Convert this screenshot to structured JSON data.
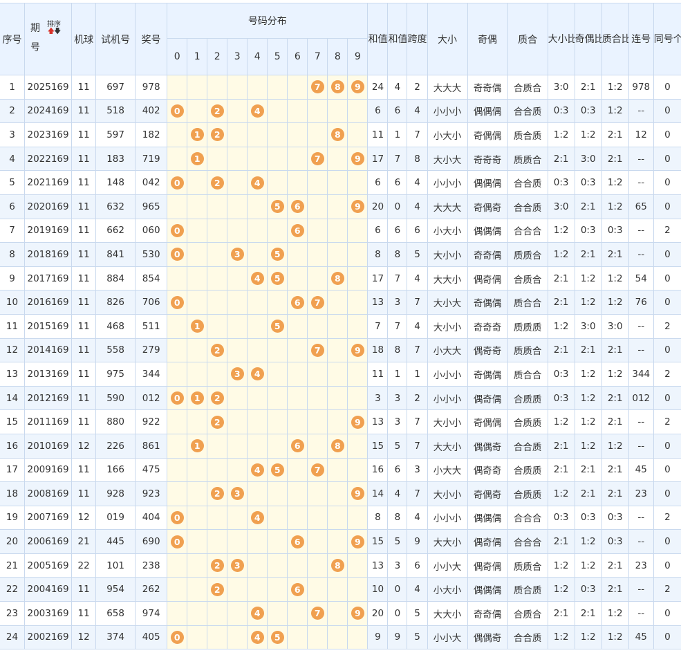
{
  "header": {
    "seq": "序号",
    "issue": "期号",
    "sort_label": "排序",
    "machine": "机球",
    "trial": "试机号",
    "prize": "奖号",
    "distribution": "号码分布",
    "digits": [
      "0",
      "1",
      "2",
      "3",
      "4",
      "5",
      "6",
      "7",
      "8",
      "9"
    ],
    "sum": "和值",
    "sum_tail": "和值尾",
    "span": "跨度",
    "size": "大小",
    "parity": "奇偶",
    "prime": "质合",
    "size_ratio": "大小比",
    "parity_ratio": "奇偶比",
    "prime_ratio": "质合比",
    "consecutive": "连号",
    "same_count": "同号个数"
  },
  "rows": [
    {
      "seq": "1",
      "issue": "2025169",
      "machine": "11",
      "trial": "697",
      "prize": "978",
      "sum": "24",
      "tail": "4",
      "span": "2",
      "size": "大大大",
      "parity": "奇奇偶",
      "prime": "合质合",
      "size_ratio": "3:0",
      "parity_ratio": "2:1",
      "prime_ratio": "1:2",
      "consec": "978",
      "same": "0"
    },
    {
      "seq": "2",
      "issue": "2024169",
      "machine": "11",
      "trial": "518",
      "prize": "402",
      "sum": "6",
      "tail": "6",
      "span": "4",
      "size": "小小小",
      "parity": "偶偶偶",
      "prime": "合合质",
      "size_ratio": "0:3",
      "parity_ratio": "0:3",
      "prime_ratio": "1:2",
      "consec": "--",
      "same": "0"
    },
    {
      "seq": "3",
      "issue": "2023169",
      "machine": "11",
      "trial": "597",
      "prize": "182",
      "sum": "11",
      "tail": "1",
      "span": "7",
      "size": "小大小",
      "parity": "奇偶偶",
      "prime": "质合质",
      "size_ratio": "1:2",
      "parity_ratio": "1:2",
      "prime_ratio": "2:1",
      "consec": "12",
      "same": "0"
    },
    {
      "seq": "4",
      "issue": "2022169",
      "machine": "11",
      "trial": "183",
      "prize": "719",
      "sum": "17",
      "tail": "7",
      "span": "8",
      "size": "大小大",
      "parity": "奇奇奇",
      "prime": "质质合",
      "size_ratio": "2:1",
      "parity_ratio": "3:0",
      "prime_ratio": "2:1",
      "consec": "--",
      "same": "0"
    },
    {
      "seq": "5",
      "issue": "2021169",
      "machine": "11",
      "trial": "148",
      "prize": "042",
      "sum": "6",
      "tail": "6",
      "span": "4",
      "size": "小小小",
      "parity": "偶偶偶",
      "prime": "合合质",
      "size_ratio": "0:3",
      "parity_ratio": "0:3",
      "prime_ratio": "1:2",
      "consec": "--",
      "same": "0"
    },
    {
      "seq": "6",
      "issue": "2020169",
      "machine": "11",
      "trial": "632",
      "prize": "965",
      "sum": "20",
      "tail": "0",
      "span": "4",
      "size": "大大大",
      "parity": "奇偶奇",
      "prime": "合合质",
      "size_ratio": "3:0",
      "parity_ratio": "2:1",
      "prime_ratio": "1:2",
      "consec": "65",
      "same": "0"
    },
    {
      "seq": "7",
      "issue": "2019169",
      "machine": "11",
      "trial": "662",
      "prize": "060",
      "sum": "6",
      "tail": "6",
      "span": "6",
      "size": "小大小",
      "parity": "偶偶偶",
      "prime": "合合合",
      "size_ratio": "1:2",
      "parity_ratio": "0:3",
      "prime_ratio": "0:3",
      "consec": "--",
      "same": "2"
    },
    {
      "seq": "8",
      "issue": "2018169",
      "machine": "11",
      "trial": "841",
      "prize": "530",
      "sum": "8",
      "tail": "8",
      "span": "5",
      "size": "大小小",
      "parity": "奇奇偶",
      "prime": "质质合",
      "size_ratio": "1:2",
      "parity_ratio": "2:1",
      "prime_ratio": "2:1",
      "consec": "--",
      "same": "0"
    },
    {
      "seq": "9",
      "issue": "2017169",
      "machine": "11",
      "trial": "884",
      "prize": "854",
      "sum": "17",
      "tail": "7",
      "span": "4",
      "size": "大大小",
      "parity": "偶奇偶",
      "prime": "合质合",
      "size_ratio": "2:1",
      "parity_ratio": "1:2",
      "prime_ratio": "1:2",
      "consec": "54",
      "same": "0"
    },
    {
      "seq": "10",
      "issue": "2016169",
      "machine": "11",
      "trial": "826",
      "prize": "706",
      "sum": "13",
      "tail": "3",
      "span": "7",
      "size": "大小大",
      "parity": "奇偶偶",
      "prime": "质合合",
      "size_ratio": "2:1",
      "parity_ratio": "1:2",
      "prime_ratio": "1:2",
      "consec": "76",
      "same": "0"
    },
    {
      "seq": "11",
      "issue": "2015169",
      "machine": "11",
      "trial": "468",
      "prize": "511",
      "sum": "7",
      "tail": "7",
      "span": "4",
      "size": "大小小",
      "parity": "奇奇奇",
      "prime": "质质质",
      "size_ratio": "1:2",
      "parity_ratio": "3:0",
      "prime_ratio": "3:0",
      "consec": "--",
      "same": "2"
    },
    {
      "seq": "12",
      "issue": "2014169",
      "machine": "11",
      "trial": "558",
      "prize": "279",
      "sum": "18",
      "tail": "8",
      "span": "7",
      "size": "小大大",
      "parity": "偶奇奇",
      "prime": "质质合",
      "size_ratio": "2:1",
      "parity_ratio": "2:1",
      "prime_ratio": "2:1",
      "consec": "--",
      "same": "0"
    },
    {
      "seq": "13",
      "issue": "2013169",
      "machine": "11",
      "trial": "975",
      "prize": "344",
      "sum": "11",
      "tail": "1",
      "span": "1",
      "size": "小小小",
      "parity": "奇偶偶",
      "prime": "质合合",
      "size_ratio": "0:3",
      "parity_ratio": "1:2",
      "prime_ratio": "1:2",
      "consec": "344",
      "same": "2"
    },
    {
      "seq": "14",
      "issue": "2012169",
      "machine": "11",
      "trial": "590",
      "prize": "012",
      "sum": "3",
      "tail": "3",
      "span": "2",
      "size": "小小小",
      "parity": "偶奇偶",
      "prime": "合质质",
      "size_ratio": "0:3",
      "parity_ratio": "1:2",
      "prime_ratio": "2:1",
      "consec": "012",
      "same": "0"
    },
    {
      "seq": "15",
      "issue": "2011169",
      "machine": "11",
      "trial": "880",
      "prize": "922",
      "sum": "13",
      "tail": "3",
      "span": "7",
      "size": "大小小",
      "parity": "奇偶偶",
      "prime": "合质质",
      "size_ratio": "1:2",
      "parity_ratio": "1:2",
      "prime_ratio": "2:1",
      "consec": "--",
      "same": "2"
    },
    {
      "seq": "16",
      "issue": "2010169",
      "machine": "12",
      "trial": "226",
      "prize": "861",
      "sum": "15",
      "tail": "5",
      "span": "7",
      "size": "大大小",
      "parity": "偶偶奇",
      "prime": "合合质",
      "size_ratio": "2:1",
      "parity_ratio": "1:2",
      "prime_ratio": "1:2",
      "consec": "--",
      "same": "0"
    },
    {
      "seq": "17",
      "issue": "2009169",
      "machine": "11",
      "trial": "166",
      "prize": "475",
      "sum": "16",
      "tail": "6",
      "span": "3",
      "size": "小大大",
      "parity": "偶奇奇",
      "prime": "合质质",
      "size_ratio": "2:1",
      "parity_ratio": "2:1",
      "prime_ratio": "2:1",
      "consec": "45",
      "same": "0"
    },
    {
      "seq": "18",
      "issue": "2008169",
      "machine": "11",
      "trial": "928",
      "prize": "923",
      "sum": "14",
      "tail": "4",
      "span": "7",
      "size": "大小小",
      "parity": "奇偶奇",
      "prime": "合质质",
      "size_ratio": "1:2",
      "parity_ratio": "2:1",
      "prime_ratio": "2:1",
      "consec": "23",
      "same": "0"
    },
    {
      "seq": "19",
      "issue": "2007169",
      "machine": "12",
      "trial": "019",
      "prize": "404",
      "sum": "8",
      "tail": "8",
      "span": "4",
      "size": "小小小",
      "parity": "偶偶偶",
      "prime": "合合合",
      "size_ratio": "0:3",
      "parity_ratio": "0:3",
      "prime_ratio": "0:3",
      "consec": "--",
      "same": "2"
    },
    {
      "seq": "20",
      "issue": "2006169",
      "machine": "21",
      "trial": "445",
      "prize": "690",
      "sum": "15",
      "tail": "5",
      "span": "9",
      "size": "大大小",
      "parity": "偶奇偶",
      "prime": "合合合",
      "size_ratio": "2:1",
      "parity_ratio": "1:2",
      "prime_ratio": "0:3",
      "consec": "--",
      "same": "0"
    },
    {
      "seq": "21",
      "issue": "2005169",
      "machine": "22",
      "trial": "101",
      "prize": "238",
      "sum": "13",
      "tail": "3",
      "span": "6",
      "size": "小小大",
      "parity": "偶奇偶",
      "prime": "质质合",
      "size_ratio": "1:2",
      "parity_ratio": "1:2",
      "prime_ratio": "2:1",
      "consec": "23",
      "same": "0"
    },
    {
      "seq": "22",
      "issue": "2004169",
      "machine": "11",
      "trial": "954",
      "prize": "262",
      "sum": "10",
      "tail": "0",
      "span": "4",
      "size": "小大小",
      "parity": "偶偶偶",
      "prime": "质合质",
      "size_ratio": "1:2",
      "parity_ratio": "0:3",
      "prime_ratio": "2:1",
      "consec": "--",
      "same": "2"
    },
    {
      "seq": "23",
      "issue": "2003169",
      "machine": "11",
      "trial": "658",
      "prize": "974",
      "sum": "20",
      "tail": "0",
      "span": "5",
      "size": "大大小",
      "parity": "奇奇偶",
      "prime": "合质合",
      "size_ratio": "2:1",
      "parity_ratio": "2:1",
      "prime_ratio": "1:2",
      "consec": "--",
      "same": "0"
    },
    {
      "seq": "24",
      "issue": "2002169",
      "machine": "12",
      "trial": "374",
      "prize": "405",
      "sum": "9",
      "tail": "9",
      "span": "5",
      "size": "小小大",
      "parity": "偶偶奇",
      "prime": "合合质",
      "size_ratio": "1:2",
      "parity_ratio": "1:2",
      "prime_ratio": "1:2",
      "consec": "45",
      "same": "0"
    }
  ],
  "colors": {
    "ball": "#f0a050",
    "header_bg": "#eaf3ff",
    "stripe": "#eef5fd",
    "dist_bg": "#fffbe6",
    "border": "#c9d9ee"
  }
}
